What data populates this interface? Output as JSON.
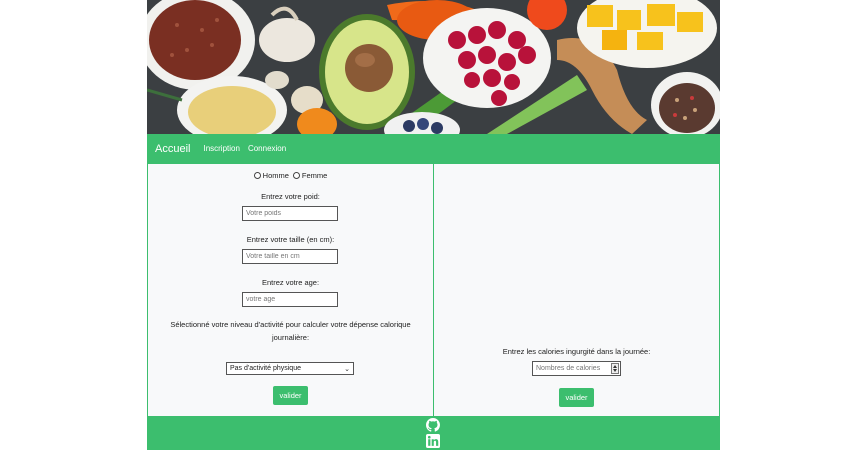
{
  "nav": {
    "brand": "Accueil",
    "links": [
      "Inscription",
      "Connexion"
    ]
  },
  "left_form": {
    "gender_options": [
      "Homme",
      "Femme"
    ],
    "weight_label": "Entrez votre poid:",
    "weight_placeholder": "Votre poids",
    "height_label": "Entrez votre taille (en cm):",
    "height_placeholder": "Votre taille en cm",
    "age_label": "Entrez votre age:",
    "age_placeholder": "votre age",
    "activity_label_line1": "Sélectionné votre niveau d'activité pour calculer votre dépense calorique",
    "activity_label_line2": "journalière:",
    "activity_selected": "Pas d'activité physique",
    "submit_label": "valider"
  },
  "right_form": {
    "calories_label": "Entrez les calories ingurgité dans la journée:",
    "calories_placeholder": "Nombres de calories",
    "submit_label": "valider"
  },
  "footer": {
    "icons": [
      "github-icon",
      "linkedin-icon"
    ]
  },
  "colors": {
    "accent": "#3cbe6e",
    "panel_bg": "#f8f9fa"
  }
}
